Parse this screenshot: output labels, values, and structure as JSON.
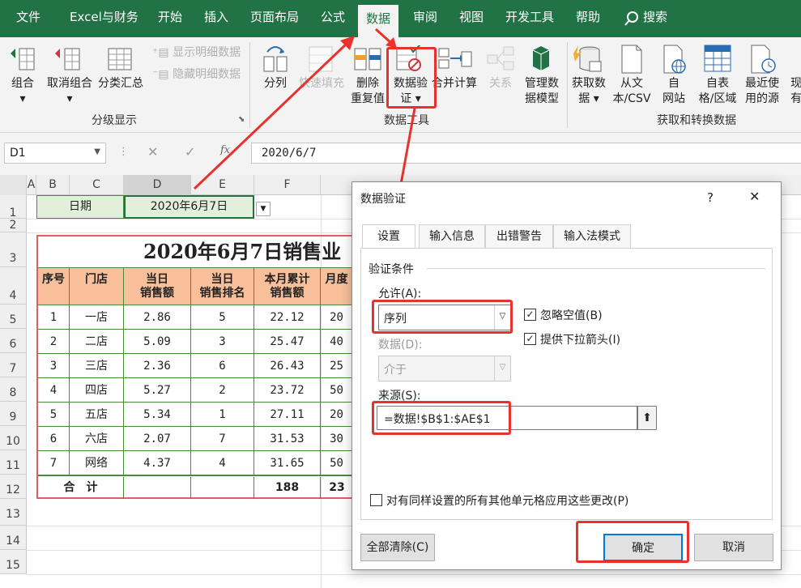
{
  "tabs": [
    "文件",
    "Excel与财务",
    "开始",
    "插入",
    "页面布局",
    "公式",
    "数据",
    "审阅",
    "视图",
    "开发工具",
    "帮助",
    "搜索"
  ],
  "ribbon": {
    "group_button": [
      "组合",
      "取消组合",
      "分类汇总"
    ],
    "show_detail": "显示明细数据",
    "hide_detail": "隐藏明细数据",
    "outline_label": "分级显示",
    "split": "分列",
    "flash_fill": "快速填充",
    "remove_dup": [
      "删除",
      "重复值"
    ],
    "data_validation": [
      "数据验",
      "证"
    ],
    "consolidate": "合并计算",
    "relations": "关系",
    "data_model": [
      "管理数",
      "据模型"
    ],
    "data_tools_label": "数据工具",
    "get_data": [
      "获取数",
      "据"
    ],
    "from_text": [
      "从文",
      "本/CSV"
    ],
    "from_web": [
      "自",
      "网站"
    ],
    "from_table": [
      "自表",
      "格/区域"
    ],
    "recent_sources": [
      "最近使",
      "用的源"
    ],
    "extra": [
      "现",
      "有"
    ],
    "get_transform_label": "获取和转换数据"
  },
  "formula_bar": {
    "name_box": "D1",
    "formula": "2020/6/7",
    "fx": "fx"
  },
  "columns": [
    "A",
    "B",
    "C",
    "D",
    "E",
    "F"
  ],
  "rows": [
    "1",
    "2",
    "3",
    "4",
    "5",
    "6",
    "7",
    "8",
    "9",
    "10",
    "11",
    "12",
    "13",
    "14",
    "15"
  ],
  "sheet": {
    "date_label": "日期",
    "date_value": "2020年6月7日",
    "title": "2020年6月7日销售业",
    "headers": [
      "序号",
      "门店",
      "当日\n销售额",
      "当日\n销售排名",
      "本月累计\n销售额",
      "月度"
    ],
    "data": [
      [
        "1",
        "一店",
        "2.86",
        "5",
        "22.12",
        "20"
      ],
      [
        "2",
        "二店",
        "5.09",
        "3",
        "25.47",
        "40"
      ],
      [
        "3",
        "三店",
        "2.36",
        "6",
        "26.43",
        "25"
      ],
      [
        "4",
        "四店",
        "5.27",
        "2",
        "23.72",
        "50"
      ],
      [
        "5",
        "五店",
        "5.34",
        "1",
        "27.11",
        "20"
      ],
      [
        "6",
        "六店",
        "2.07",
        "7",
        "31.53",
        "30"
      ],
      [
        "7",
        "网络",
        "4.37",
        "4",
        "31.65",
        "50"
      ]
    ],
    "total_label": "合　计",
    "total_f": "188",
    "total_g": "23"
  },
  "dialog": {
    "title": "数据验证",
    "help": "?",
    "close": "✕",
    "tabs": [
      "设置",
      "输入信息",
      "出错警告",
      "输入法模式"
    ],
    "criteria_label": "验证条件",
    "allow_label": "允许(A):",
    "allow_value": "序列",
    "ignore_blank": "忽略空值(B)",
    "in_cell_dropdown": "提供下拉箭头(I)",
    "data_label": "数据(D):",
    "data_value": "介于",
    "source_label": "来源(S):",
    "source_value": "=数据!$B$1:$AE$1",
    "apply_all": "对有同样设置的所有其他单元格应用这些更改(P)",
    "clear_all": "全部清除(C)",
    "ok": "确定",
    "cancel": "取消"
  },
  "colors": {
    "excel_green": "#217346",
    "highlight_red": "#e8322e",
    "header_orange": "#f7c09b",
    "date_fill": "#e2efda"
  }
}
